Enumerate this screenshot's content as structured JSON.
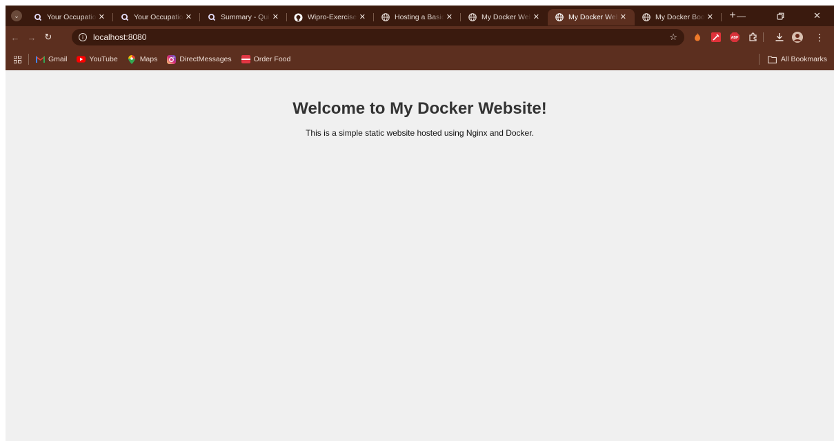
{
  "browser": {
    "tabs": [
      {
        "title": "Your Occupation",
        "favicon": "quizizz-q-icon",
        "active": false
      },
      {
        "title": "Your Occupation",
        "favicon": "quizizz-q-icon",
        "active": false
      },
      {
        "title": "Summary - Quizizz",
        "favicon": "quizizz-q-icon",
        "active": false
      },
      {
        "title": "Wipro-Exercises",
        "favicon": "github-icon",
        "active": false
      },
      {
        "title": "Hosting a Basic Website",
        "favicon": "globe-icon",
        "active": false
      },
      {
        "title": "My Docker Website",
        "favicon": "globe-icon",
        "active": false
      },
      {
        "title": "My Docker Website",
        "favicon": "globe-icon",
        "active": true
      },
      {
        "title": "My Docker Bootstrap",
        "favicon": "globe-icon",
        "active": false
      }
    ],
    "address_bar": {
      "url": "localhost:8080"
    },
    "bookmarks": [
      {
        "label": "Gmail",
        "icon": "gmail-icon"
      },
      {
        "label": "YouTube",
        "icon": "youtube-icon"
      },
      {
        "label": "Maps",
        "icon": "maps-icon"
      },
      {
        "label": "DirectMessages",
        "icon": "instagram-icon"
      },
      {
        "label": "Order Food",
        "icon": "food-icon"
      }
    ],
    "all_bookmarks_label": "All Bookmarks"
  },
  "page": {
    "heading": "Welcome to My Docker Website!",
    "paragraph": "This is a simple static website hosted using Nginx and Docker."
  },
  "colors": {
    "tabstrip_bg": "#3a1a0e",
    "toolbar_bg": "#5c2f1f",
    "page_bg": "#f0f0f0",
    "heading": "#333333"
  }
}
